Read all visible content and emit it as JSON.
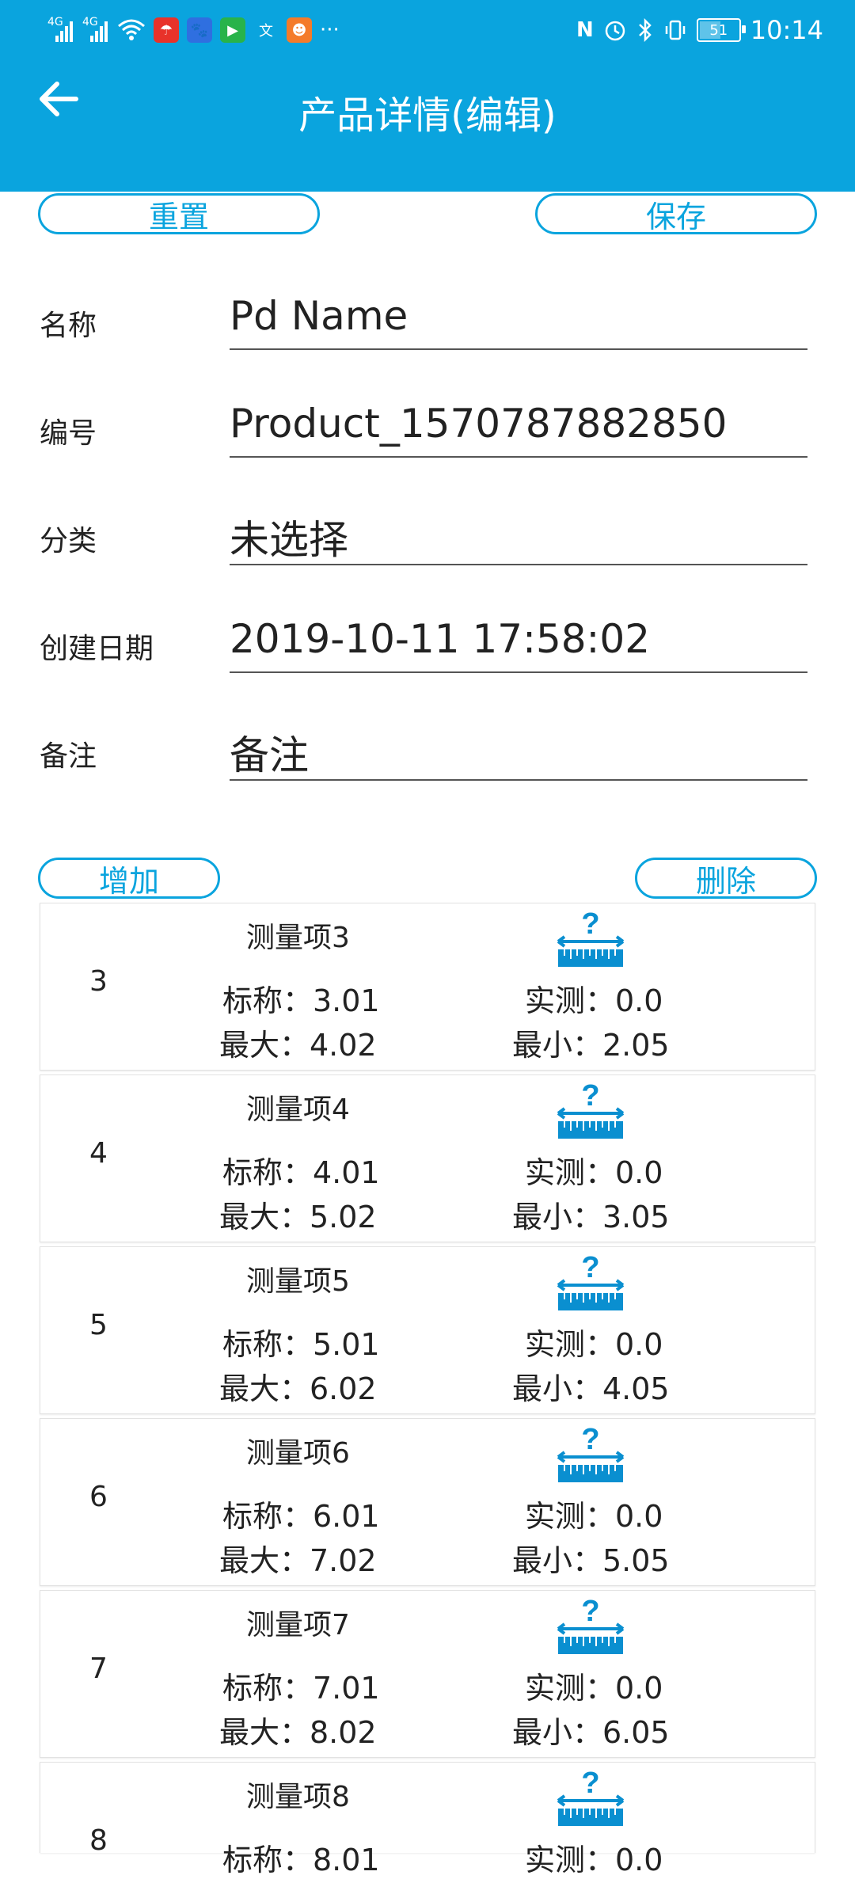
{
  "status_bar": {
    "network_labels": [
      "4G",
      "4G"
    ],
    "battery": "51",
    "time": "10:14",
    "more": "···"
  },
  "header": {
    "title": "产品详情(编辑)"
  },
  "actions": {
    "reset_label": "重置",
    "save_label": "保存",
    "add_label": "增加",
    "delete_label": "删除"
  },
  "form": {
    "name_label": "名称",
    "name_value": "Pd Name",
    "code_label": "编号",
    "code_value": "Product_1570787882850",
    "category_label": "分类",
    "category_value": "未选择",
    "created_label": "创建日期",
    "created_value": "2019-10-11 17:58:02",
    "note_label": "备注",
    "note_value": "备注"
  },
  "items": [
    {
      "index": "3",
      "name": "测量项3",
      "nominal": "标称：3.01",
      "measured": "实测：0.0",
      "max": "最大：4.02",
      "min": "最小：2.05"
    },
    {
      "index": "4",
      "name": "测量项4",
      "nominal": "标称：4.01",
      "measured": "实测：0.0",
      "max": "最大：5.02",
      "min": "最小：3.05"
    },
    {
      "index": "5",
      "name": "测量项5",
      "nominal": "标称：5.01",
      "measured": "实测：0.0",
      "max": "最大：6.02",
      "min": "最小：4.05"
    },
    {
      "index": "6",
      "name": "测量项6",
      "nominal": "标称：6.01",
      "measured": "实测：0.0",
      "max": "最大：7.02",
      "min": "最小：5.05"
    },
    {
      "index": "7",
      "name": "测量项7",
      "nominal": "标称：7.01",
      "measured": "实测：0.0",
      "max": "最大：8.02",
      "min": "最小：6.05"
    },
    {
      "index": "8",
      "name": "测量项8",
      "nominal": "标称：8.01",
      "measured": "实测：0.0",
      "max": "",
      "min": ""
    }
  ],
  "colors": {
    "primary": "#0aa4de",
    "text": "#222222"
  }
}
